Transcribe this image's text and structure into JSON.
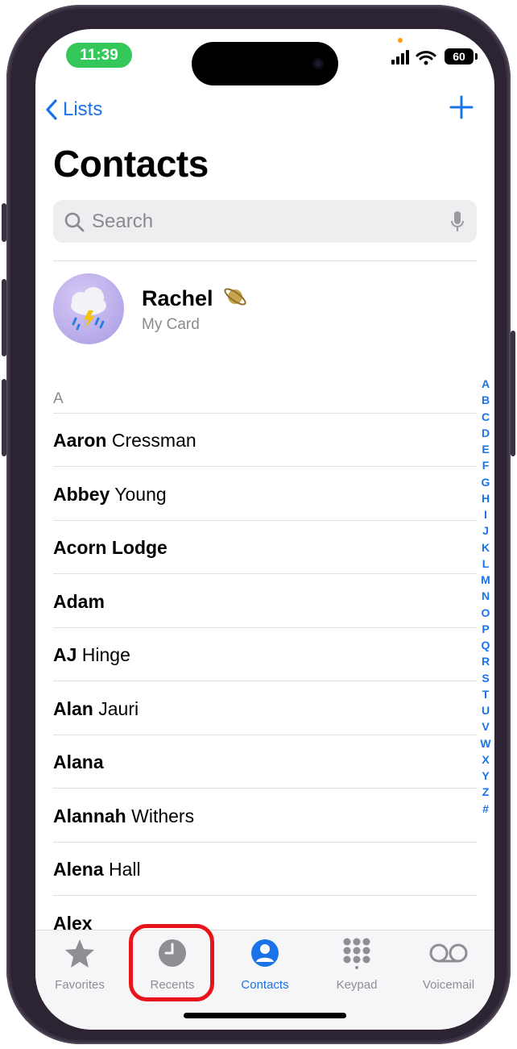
{
  "status_bar": {
    "time": "11:39",
    "battery": "60"
  },
  "nav": {
    "back_label": "Lists",
    "add_label": "+"
  },
  "page_title": "Contacts",
  "search": {
    "placeholder": "Search"
  },
  "my_card": {
    "name": "Rachel",
    "subtitle": "My Card",
    "avatar_icon": "storm-cloud-icon",
    "badge_icon": "planet-icon"
  },
  "section_header": "A",
  "contacts": [
    {
      "first": "Aaron",
      "last": " Cressman"
    },
    {
      "first": "Abbey",
      "last": " Young"
    },
    {
      "first": "Acorn Lodge",
      "last": ""
    },
    {
      "first": "Adam",
      "last": ""
    },
    {
      "first": "AJ",
      "last": " Hinge"
    },
    {
      "first": "Alan",
      "last": " Jauri"
    },
    {
      "first": "Alana",
      "last": ""
    },
    {
      "first": "Alannah",
      "last": " Withers"
    },
    {
      "first": "Alena",
      "last": " Hall"
    },
    {
      "first": "Alex",
      "last": ""
    }
  ],
  "index_letters": [
    "A",
    "B",
    "C",
    "D",
    "E",
    "F",
    "G",
    "H",
    "I",
    "J",
    "K",
    "L",
    "M",
    "N",
    "O",
    "P",
    "Q",
    "R",
    "S",
    "T",
    "U",
    "V",
    "W",
    "X",
    "Y",
    "Z",
    "#"
  ],
  "tabs": [
    {
      "label": "Favorites",
      "icon": "star-icon"
    },
    {
      "label": "Recents",
      "icon": "clock-icon"
    },
    {
      "label": "Contacts",
      "icon": "person-circle-icon"
    },
    {
      "label": "Keypad",
      "icon": "keypad-icon"
    },
    {
      "label": "Voicemail",
      "icon": "voicemail-icon"
    }
  ],
  "active_tab": "Contacts",
  "colors": {
    "accent": "#1a73e8",
    "time_pill": "#34c759",
    "highlight": "#e8141c"
  }
}
